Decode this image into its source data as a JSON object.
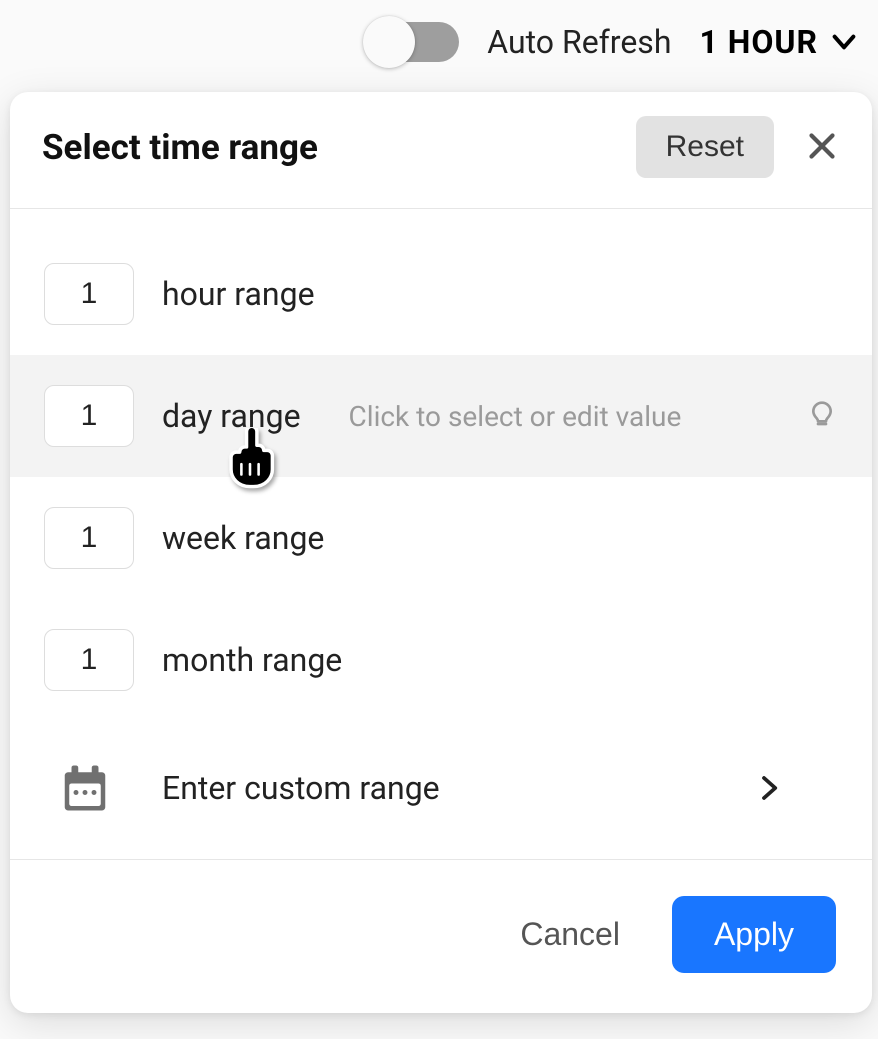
{
  "topbar": {
    "auto_refresh_label": "Auto Refresh",
    "selected_value": "1 HOUR"
  },
  "dialog": {
    "title": "Select time range",
    "reset_label": "Reset",
    "ranges": [
      {
        "value": "1",
        "label": "hour range"
      },
      {
        "value": "1",
        "label": "day range",
        "hint": "Click to select or edit value"
      },
      {
        "value": "1",
        "label": "week range"
      },
      {
        "value": "1",
        "label": "month range"
      }
    ],
    "custom_label": "Enter custom range",
    "cancel_label": "Cancel",
    "apply_label": "Apply"
  }
}
